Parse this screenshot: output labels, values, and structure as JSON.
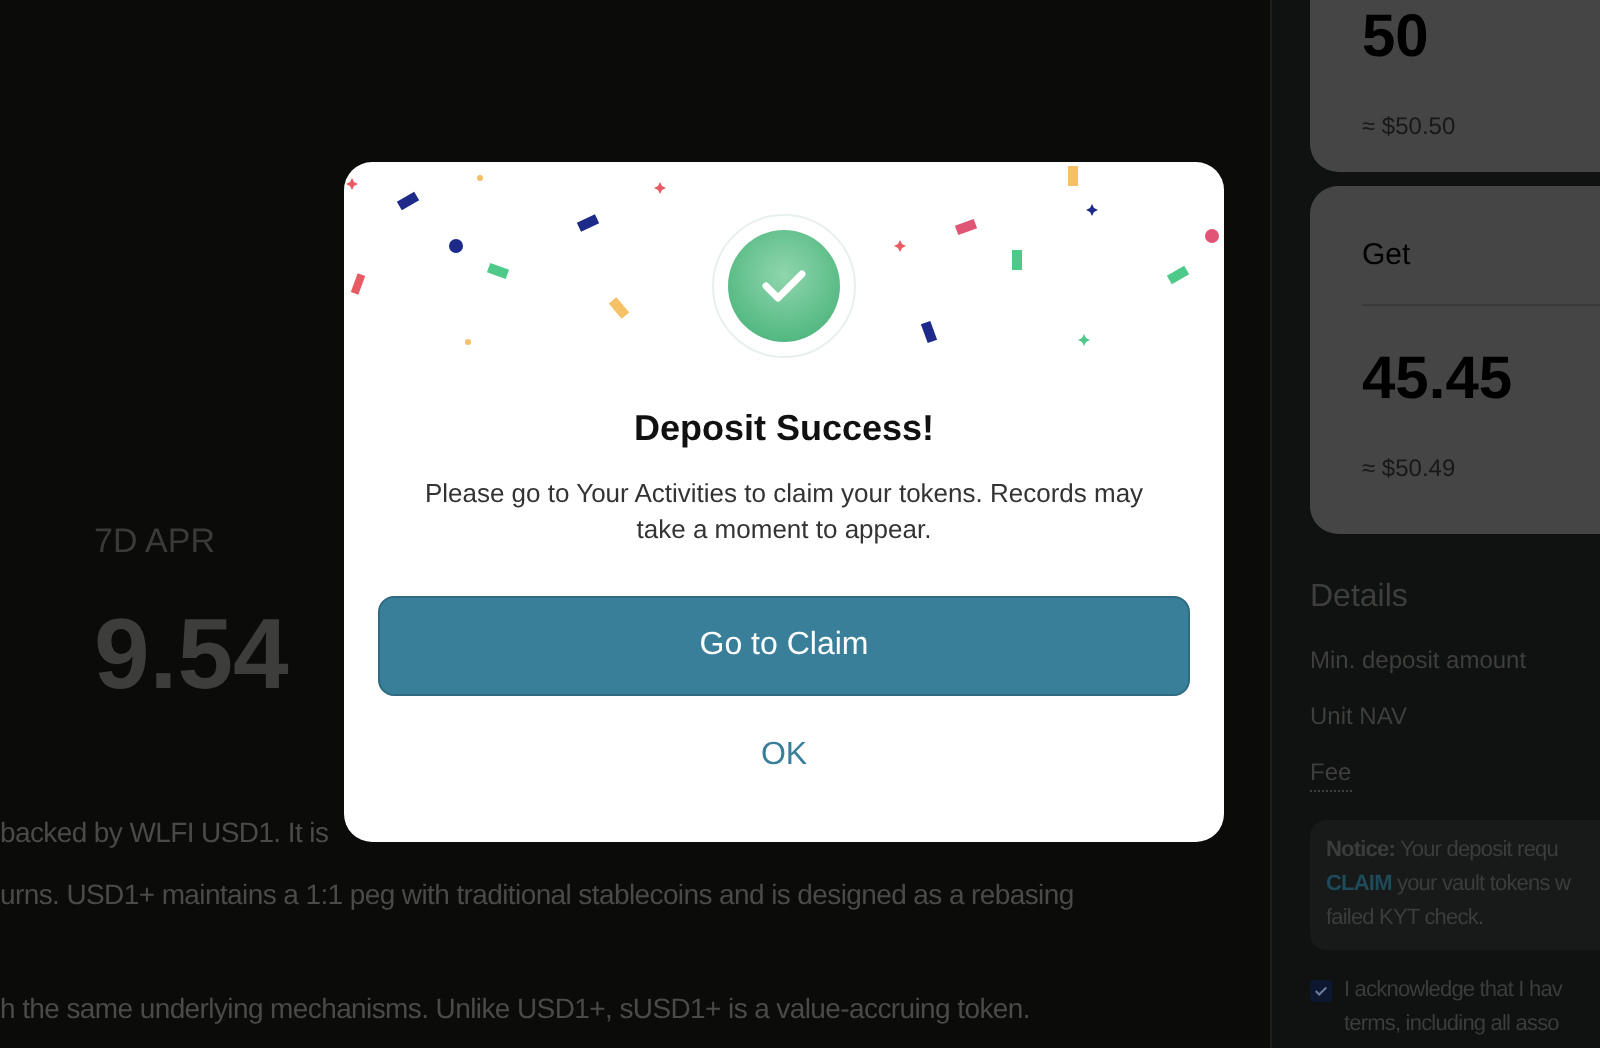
{
  "apr": {
    "label": "7D APR",
    "value": "9.54"
  },
  "description": [
    "backed by WLFI USD1. It is",
    "urns. USD1+ maintains a 1:1 peg with traditional stablecoins and is designed as a rebasing",
    "h the same underlying mechanisms. Unlike USD1+, sUSD1+ is a value-accruing token."
  ],
  "pay_card": {
    "amount": "50",
    "usd": "≈ $50.50"
  },
  "get_card": {
    "label": "Get",
    "amount": "45.45",
    "usd": "≈ $50.49"
  },
  "details": {
    "title": "Details",
    "rows": [
      "Min. deposit amount",
      "Unit NAV",
      "Fee"
    ]
  },
  "notice": {
    "lines": [
      "**Notice:** Your deposit requ",
      "CLAIM your vault tokens w",
      "failed KYT check."
    ]
  },
  "acknowledge": {
    "checked": true,
    "lines": [
      "I acknowledge that I hav",
      "terms, including all asso"
    ]
  },
  "modal": {
    "title": "Deposit Success!",
    "message": "Please go to Your Activities to claim your tokens. Records may take a moment to appear.",
    "primary_button": "Go to Claim",
    "secondary_button": "OK"
  }
}
